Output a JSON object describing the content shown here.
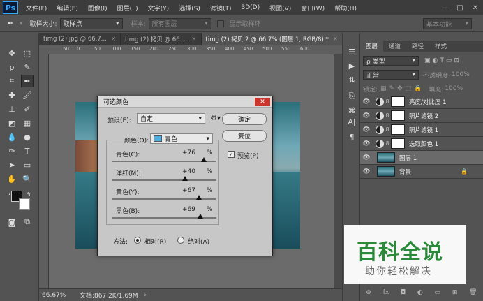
{
  "app": {
    "logo": "Ps"
  },
  "menu": [
    "文件(F)",
    "编辑(E)",
    "图像(I)",
    "图层(L)",
    "文字(Y)",
    "选择(S)",
    "滤镜(T)",
    "3D(D)",
    "视图(V)",
    "窗口(W)",
    "帮助(H)"
  ],
  "window_controls": {
    "minimize": "—",
    "maximize": "□",
    "close": "✕"
  },
  "options_bar": {
    "sample_size_label": "取样大小:",
    "sample_size_value": "取样点",
    "sample_label": "样本:",
    "sample_value": "所有图层",
    "show_ring_label": "显示取样环",
    "workspace": "基本功能"
  },
  "tabs": [
    {
      "label": "timg (2).jpg @ 66.7...",
      "active": false
    },
    {
      "label": "timg (2) 拷贝 @ 66....",
      "active": false
    },
    {
      "label": "timg (2) 拷贝 2 @ 66.7% (图层 1, RGB/8) *",
      "active": true
    }
  ],
  "ruler_ticks": [
    "50",
    "0",
    "50",
    "100",
    "150",
    "200",
    "250",
    "300",
    "350",
    "400",
    "450",
    "500",
    "550",
    "600"
  ],
  "status": {
    "zoom": "66.67%",
    "doc": "文档:867.2K/1.69M"
  },
  "layers_panel": {
    "tabs": [
      "图层",
      "通道",
      "路径",
      "样式"
    ],
    "filter_kind": "ρ 类型",
    "blend_mode": "正常",
    "opacity_label": "不透明度:",
    "opacity_value": "100%",
    "lock_label": "锁定:",
    "fill_label": "填充:",
    "fill_value": "100%",
    "layers": [
      {
        "name": "亮度/对比度 1",
        "type": "adjustment",
        "selected": false,
        "locked": false
      },
      {
        "name": "照片滤镜 2",
        "type": "adjustment",
        "selected": false,
        "locked": false
      },
      {
        "name": "照片滤镜 1",
        "type": "adjustment",
        "selected": false,
        "locked": false
      },
      {
        "name": "选取颜色 1",
        "type": "adjustment",
        "selected": false,
        "locked": false
      },
      {
        "name": "图层 1",
        "type": "image",
        "selected": true,
        "locked": false
      },
      {
        "name": "背景",
        "type": "image",
        "selected": false,
        "locked": true
      }
    ],
    "footer": [
      "⊖",
      "fx",
      "◘",
      "◐",
      "▭",
      "⊞",
      "🗑"
    ]
  },
  "dialog": {
    "title": "可选颜色",
    "preset_label": "预设(E):",
    "preset_value": "自定",
    "ok_label": "确定",
    "reset_label": "复位",
    "preview_label": "预览(P)",
    "preview_checked": true,
    "colors_label": "颜色(O):",
    "colors_value": "青色",
    "colors_swatch": "#4ab0e0",
    "sliders": [
      {
        "label": "青色(C):",
        "value": "+76",
        "unit": "%",
        "level": 76
      },
      {
        "label": "洋红(M):",
        "value": "+40",
        "unit": "%",
        "level": 40
      },
      {
        "label": "黄色(Y):",
        "value": "+67",
        "unit": "%",
        "level": 67
      },
      {
        "label": "黑色(B):",
        "value": "+69",
        "unit": "%",
        "level": 69
      }
    ],
    "method_label": "方法:",
    "method_relative": "相对(R)",
    "method_absolute": "绝对(A)",
    "method_selected": "relative"
  },
  "watermark": {
    "main": "百科全说",
    "sub": "助你轻松解决"
  }
}
